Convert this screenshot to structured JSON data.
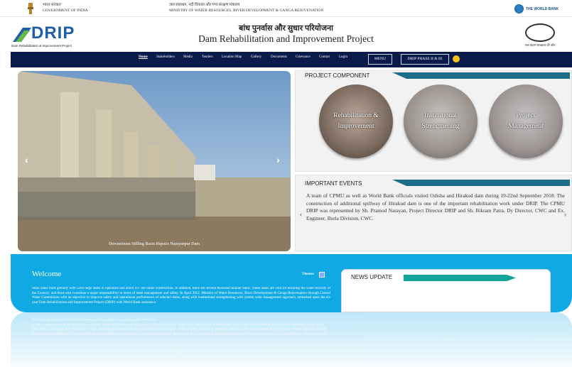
{
  "gov_bar": {
    "gov_hindi": "भारत सरकार",
    "gov_english": "GOVERNMENT OF INDIA",
    "ministry_hindi": "जल संसाधन, नदी विकास और गंगा संरक्षण मंत्रालय",
    "ministry_english": "MINISTRY OF WATER RESOURCES, RIVER DEVELOPMENT & GANGA REJUVENATION",
    "world_bank": "THE WORLD BANK"
  },
  "header": {
    "logo_text": "DRIP",
    "logo_sub": "Dam Rehabilitation & Improvement Project",
    "title_hindi": "बांध पुनर्वास और सुधार परियोजना",
    "title_english": "Dam Rehabilitation and Improvement Project",
    "jal_tagline": "एक कदम स्वच्छता की ओर"
  },
  "nav": {
    "items": [
      {
        "label": "Home",
        "active": true
      },
      {
        "label": "Stakeholders"
      },
      {
        "label": "Media"
      },
      {
        "label": "Tenders"
      },
      {
        "label": "Location Map"
      },
      {
        "label": "Gallery"
      },
      {
        "label": "Documents"
      },
      {
        "label": "Grievance"
      },
      {
        "label": "Contact"
      },
      {
        "label": "Login"
      }
    ],
    "menu_label": "MENU",
    "phase_label": "DRIP PHASE II & III"
  },
  "slider": {
    "prev": "‹",
    "next": "›",
    "caption": "Downstream Stilling Basin Repairs Narayanpur Dam"
  },
  "project_component": {
    "title": "PROJECT COMPONENT",
    "items": [
      {
        "line1": "Rehabilitation &",
        "line2": "Improvement"
      },
      {
        "line1": "Institutional",
        "line2": "Strengthening"
      },
      {
        "line1": "Project",
        "line2": "Management"
      }
    ]
  },
  "events": {
    "title": "IMPORTANT EVENTS",
    "text": "A team of CPMU as well as World Bank officials visited Odisha and Hirakud dam during 19-22nd September 2018. The construction of additional spillway of Hirakud dam is one of the important rehabilitation work under DRIP. The CPMU DRIP was represented by Sh. Pramod Narayan, Project Director DRIP and Sh. Bikram Patra, Dy Director, CWC and Ex. Engineer, Burla Division, CWC.",
    "prev": "‹",
    "next": "›"
  },
  "welcome": {
    "title": "Welcome",
    "themes_label": "Themes",
    "text": "India ranks third globally with 5264 large dams in operation and about 437 are under construction. In addition, there are several thousand smaller dams. These dams are vital for ensuring the water security of the Country; and these also constitute a major responsibility in terms of asset management and safety. In April 2012, Ministry of Water Resources, River Development & Ganga Rejuvenation through Central Water Commission with an objective to improve safety and operational performance of selected dams, along with institutional strengthening with system wide management approach, embarked upon the six year Dam Rehabilitation and Improvement Project (DRIP) with World Bank assistance."
  },
  "news": {
    "title": "NEWS UPDATE"
  },
  "colors": {
    "nav_bg": "#0a1a4a",
    "section_blue": "#11a9e3",
    "panel_bar": "#1f6b8a",
    "news_bar": "#12a39a"
  }
}
